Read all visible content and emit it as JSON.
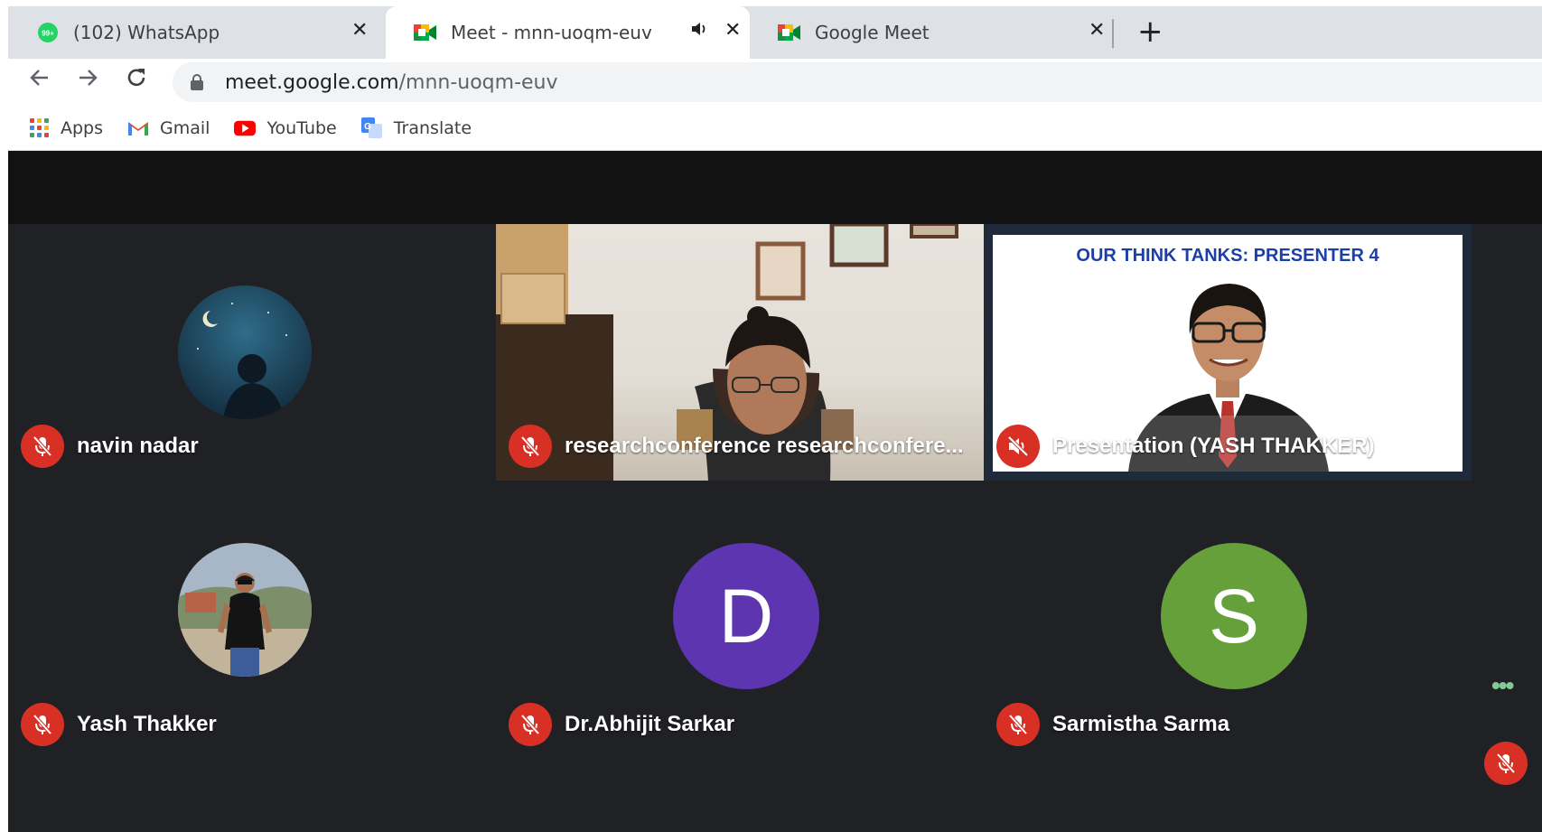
{
  "browser": {
    "tabs": [
      {
        "title": "(102) WhatsApp",
        "favicon": "whatsapp-icon",
        "badge": "99+",
        "active": false
      },
      {
        "title": "Meet - mnn-uoqm-euv",
        "favicon": "google-meet-icon",
        "active": true,
        "audio": true
      },
      {
        "title": "Google Meet",
        "favicon": "google-meet-icon",
        "active": false
      }
    ],
    "close_glyph": "✕",
    "new_tab_glyph": "+",
    "url_host": "meet.google.com",
    "url_path": "/mnn-uoqm-euv",
    "bookmarks": [
      {
        "label": "Apps",
        "icon": "apps-grid-icon"
      },
      {
        "label": "Gmail",
        "icon": "gmail-icon"
      },
      {
        "label": "YouTube",
        "icon": "youtube-icon"
      },
      {
        "label": "Translate",
        "icon": "translate-icon"
      }
    ]
  },
  "meet": {
    "participants": [
      {
        "name": "navin nadar",
        "muted": true,
        "avatar": "night-sky-photo"
      },
      {
        "name": "researchconference researchconfere...",
        "muted": true,
        "video": "camera-feed"
      },
      {
        "name": "Presentation (YASH THAKKER)",
        "muted": true,
        "video": "shared-slide"
      },
      {
        "name": "Yash Thakker",
        "muted": true,
        "avatar": "outdoor-photo"
      },
      {
        "name": "Dr.Abhijit Sarkar",
        "muted": true,
        "initial": "D",
        "color": "#5e35b1"
      },
      {
        "name": "Sarmistha Sarma",
        "muted": true,
        "initial": "S",
        "color": "#66a03a"
      }
    ],
    "slide_title": "OUR THINK TANKS: PRESENTER 4",
    "more_glyph": "•••"
  },
  "colors": {
    "meet_bg": "#202124",
    "mute_red": "#d93025",
    "slide_title_blue": "#1b3fa6"
  }
}
